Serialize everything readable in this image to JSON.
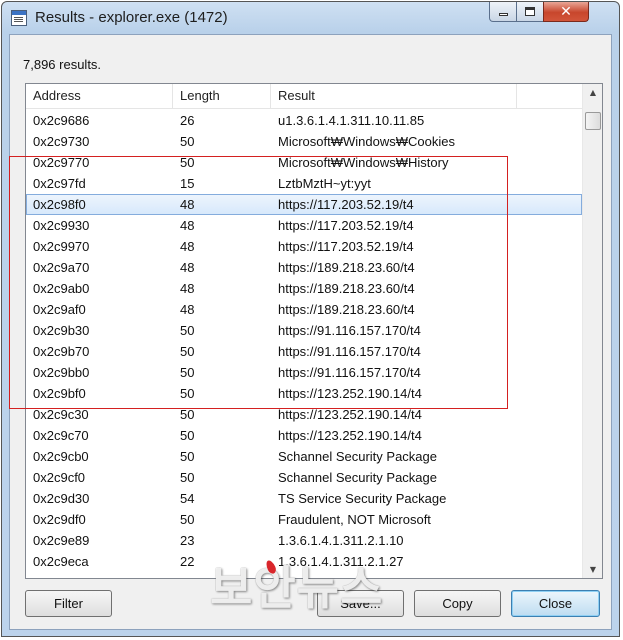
{
  "window": {
    "title": "Results - explorer.exe (1472)",
    "icon": "app-window-icon",
    "controls": [
      "minimize-icon",
      "maximize-icon",
      "close-icon"
    ],
    "close_glyph": "✕"
  },
  "summary": {
    "count_text": "7,896 results."
  },
  "table": {
    "columns": [
      "Address",
      "Length",
      "Result"
    ],
    "rows": [
      {
        "address": "0x2c9686",
        "length": "26",
        "result": "u1.3.6.1.4.1.311.10.11.85"
      },
      {
        "address": "0x2c9730",
        "length": "50",
        "result": "Microsoft₩Windows₩Cookies"
      },
      {
        "address": "0x2c9770",
        "length": "50",
        "result": "Microsoft₩Windows₩History"
      },
      {
        "address": "0x2c97fd",
        "length": "15",
        "result": "LztbMztH~yt:yyt"
      },
      {
        "address": "0x2c98f0",
        "length": "48",
        "result": "https://117.203.52.19/t4",
        "selected": true
      },
      {
        "address": "0x2c9930",
        "length": "48",
        "result": "https://117.203.52.19/t4"
      },
      {
        "address": "0x2c9970",
        "length": "48",
        "result": "https://117.203.52.19/t4"
      },
      {
        "address": "0x2c9a70",
        "length": "48",
        "result": "https://189.218.23.60/t4"
      },
      {
        "address": "0x2c9ab0",
        "length": "48",
        "result": "https://189.218.23.60/t4"
      },
      {
        "address": "0x2c9af0",
        "length": "48",
        "result": "https://189.218.23.60/t4"
      },
      {
        "address": "0x2c9b30",
        "length": "50",
        "result": "https://91.116.157.170/t4"
      },
      {
        "address": "0x2c9b70",
        "length": "50",
        "result": "https://91.116.157.170/t4"
      },
      {
        "address": "0x2c9bb0",
        "length": "50",
        "result": "https://91.116.157.170/t4"
      },
      {
        "address": "0x2c9bf0",
        "length": "50",
        "result": "https://123.252.190.14/t4"
      },
      {
        "address": "0x2c9c30",
        "length": "50",
        "result": "https://123.252.190.14/t4"
      },
      {
        "address": "0x2c9c70",
        "length": "50",
        "result": "https://123.252.190.14/t4"
      },
      {
        "address": "0x2c9cb0",
        "length": "50",
        "result": "Schannel Security Package"
      },
      {
        "address": "0x2c9cf0",
        "length": "50",
        "result": "Schannel Security Package"
      },
      {
        "address": "0x2c9d30",
        "length": "54",
        "result": "TS Service Security Package"
      },
      {
        "address": "0x2c9df0",
        "length": "50",
        "result": "Fraudulent, NOT Microsoft"
      },
      {
        "address": "0x2c9e89",
        "length": "23",
        "result": "1.3.6.1.4.1.311.2.1.10"
      },
      {
        "address": "0x2c9eca",
        "length": "22",
        "result": "1.3.6.1.4.1.311.2.1.27"
      }
    ]
  },
  "scrollbar": {
    "up_arrow": "▲",
    "down_arrow": "▼"
  },
  "buttons": {
    "filter": "Filter",
    "save": "Save...",
    "copy": "Copy",
    "close": "Close"
  },
  "watermark": {
    "text": "보안뉴스"
  },
  "colors": {
    "highlight_border": "#d42020",
    "selection": "#d6e8fb"
  }
}
